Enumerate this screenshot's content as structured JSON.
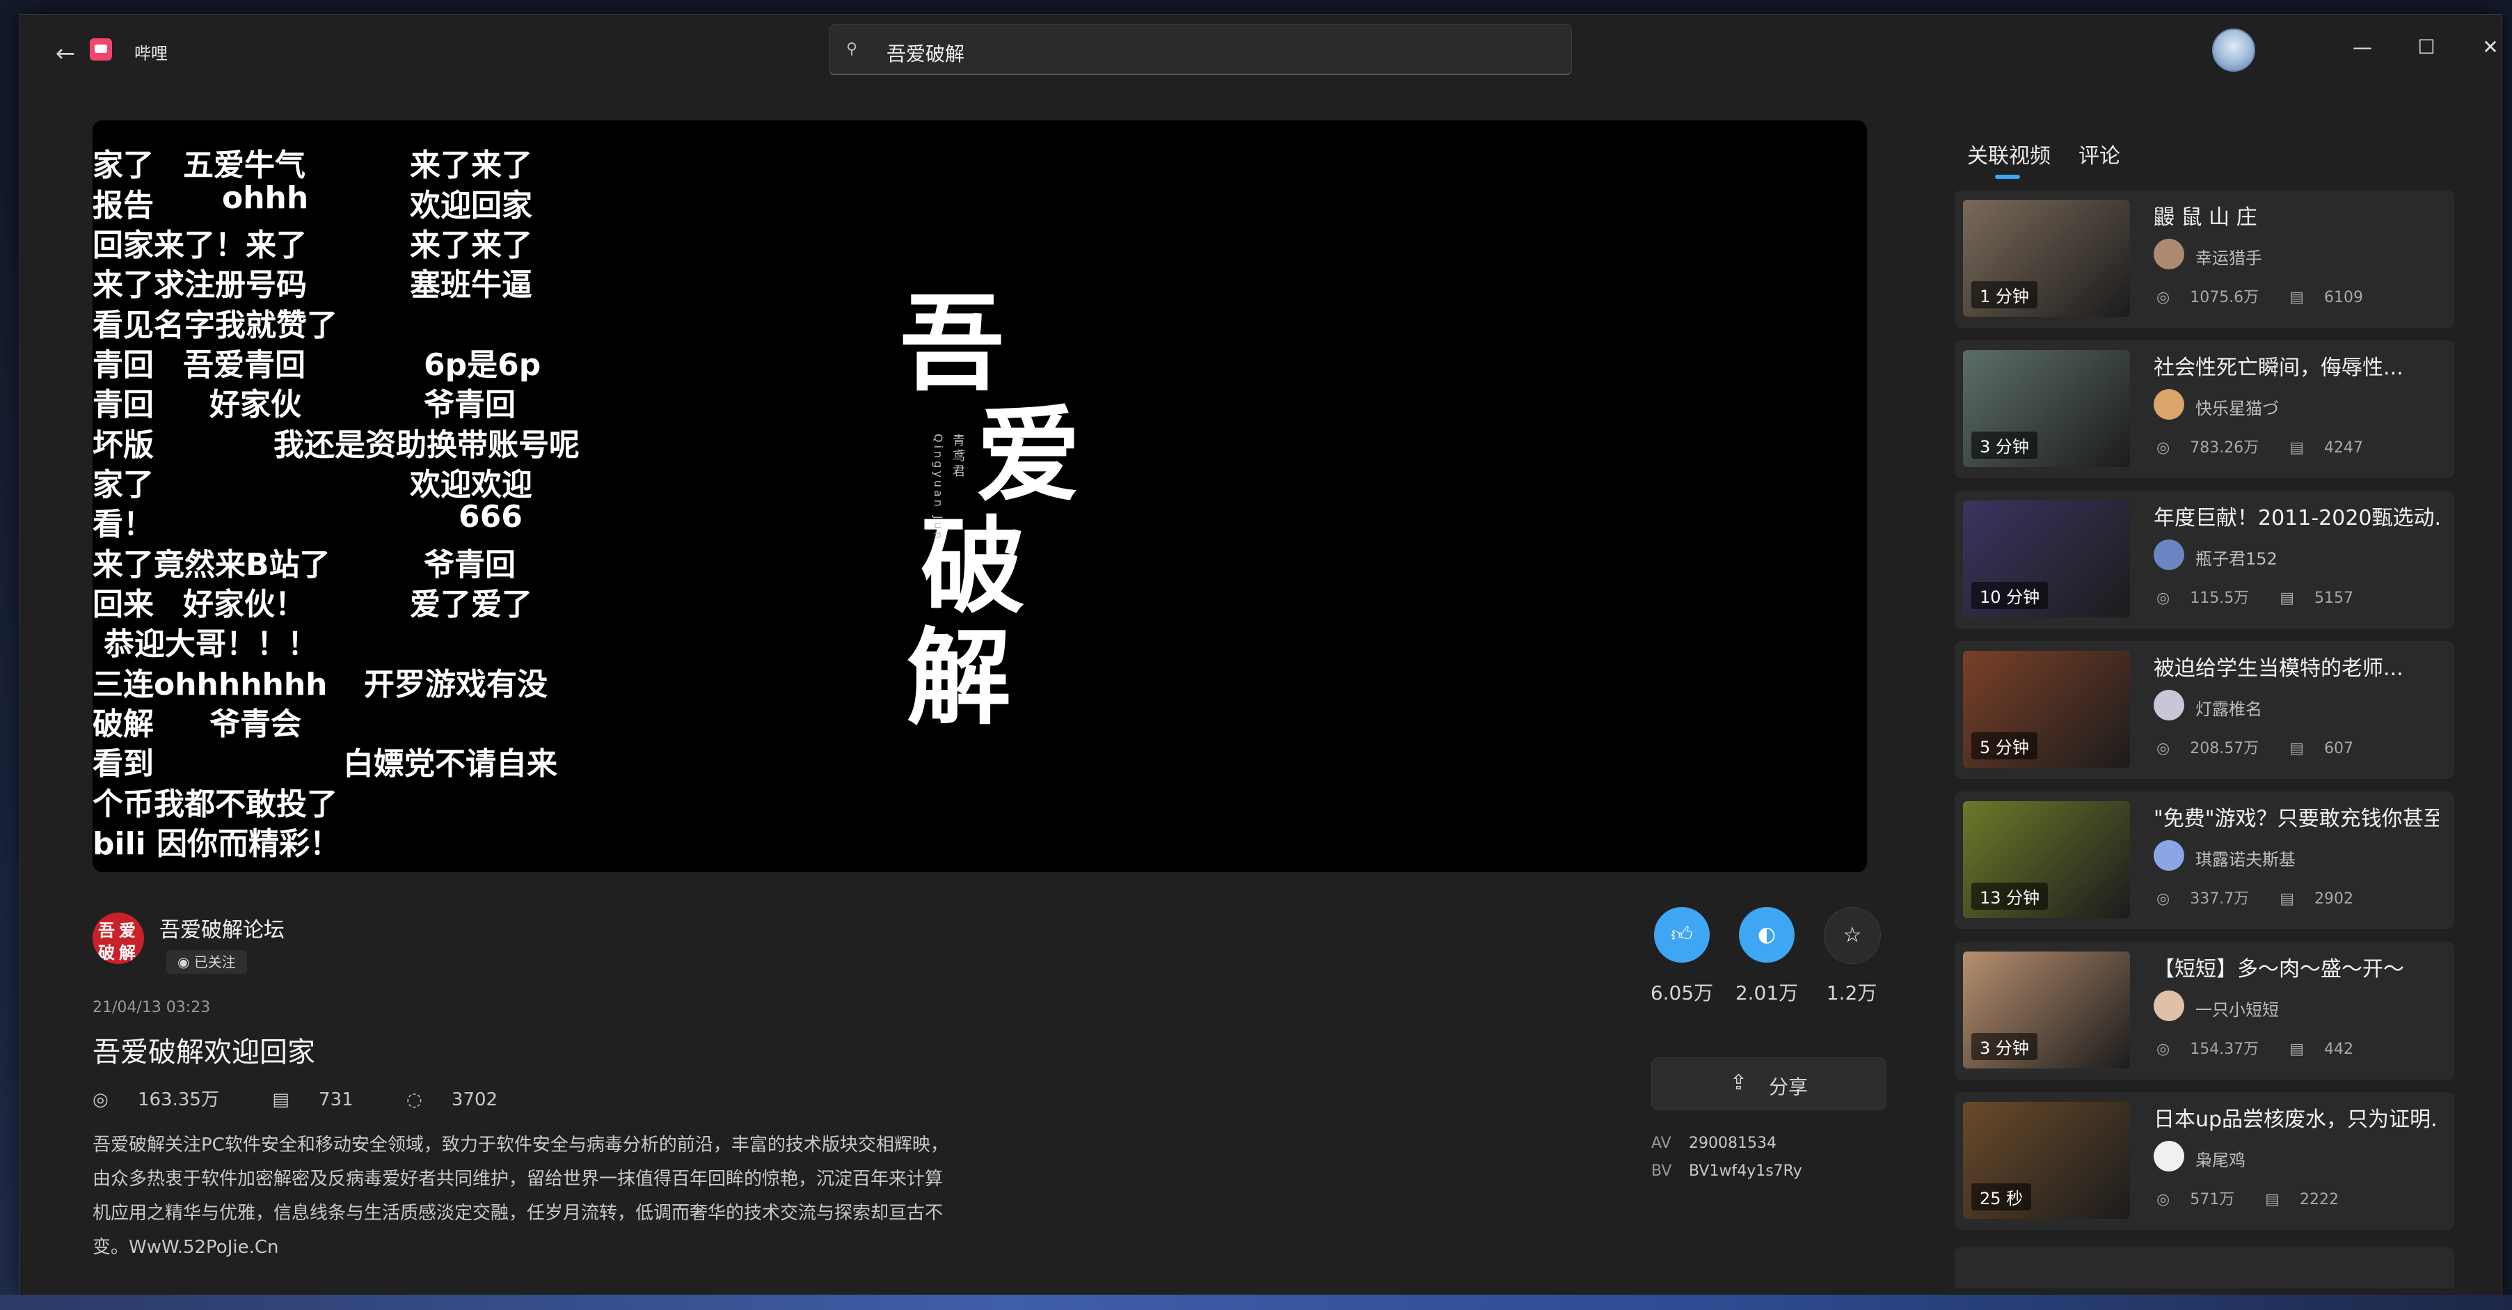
{
  "app": {
    "name": "哔哩"
  },
  "search": {
    "query": "吾爱破解"
  },
  "danmaku": [
    "家了",
    "五爱牛气",
    "来了来了",
    "报告",
    "ohhh",
    "欢迎回家",
    "回家",
    "来了！来了",
    "来了来了",
    "来了",
    "求注册号码",
    "塞班牛逼",
    "看见名字我就赞了",
    "青回",
    "吾爱青回",
    "6p是6p",
    "青回",
    "好家伙",
    "爷青回",
    "坏版",
    "我还是资助换带账号呢",
    "家了",
    "欢迎欢迎",
    "看！",
    "666",
    "来了竟然来B站了",
    "爷青回",
    "回来",
    "好家伙！",
    "爱了爱了",
    "恭迎大哥！！！",
    "三连ohhhhhhh",
    "开罗游戏有没",
    "破解",
    "爷青会",
    "看到",
    "白嫖党不请自来",
    "个币我都不敢投了",
    "bili 因你而精彩！"
  ],
  "cover": {
    "chars": [
      "吾",
      "爱",
      "破",
      "解"
    ],
    "signature_cn": "青鸢君",
    "signature_en": "Qingyuan Jun"
  },
  "uploader": {
    "name": "吾爱破解论坛",
    "followed": "已关注",
    "avatar_text": [
      "吾",
      "爱",
      "破",
      "解"
    ]
  },
  "video": {
    "date": "21/04/13 03:23",
    "title": "吾爱破解欢迎回家",
    "views": "163.35万",
    "danmaku_count": "731",
    "replies": "3702",
    "description": "吾爱破解关注PC软件安全和移动安全领域，致力于软件安全与病毒分析的前沿，丰富的技术版块交相辉映，由众多热衷于软件加密解密及反病毒爱好者共同维护，留给世界一抹值得百年回眸的惊艳，沉淀百年来计算机应用之精华与优雅，信息线条与生活质感淡定交融，任岁月流转，低调而奢华的技术交流与探索却亘古不变。WwW.52PoJie.Cn"
  },
  "actions": {
    "like": "6.05万",
    "coin": "2.01万",
    "favorite": "1.2万",
    "share_label": "分享"
  },
  "ids": {
    "av_label": "AV",
    "av": "290081534",
    "bv_label": "BV",
    "bv": "BV1wf4y1s7Ry"
  },
  "tabs": [
    "关联视频",
    "评论"
  ],
  "related": [
    {
      "title": "鼹 鼠 山 庄",
      "author": "幸运猎手",
      "views": "1075.6万",
      "danmaku": "6109",
      "duration": "1 分钟",
      "thumb_color": "#7a6a5a",
      "avatar_color": "#b08a70"
    },
    {
      "title": "社会性死亡瞬间，侮辱性...",
      "author": "快乐星猫づ",
      "views": "783.26万",
      "danmaku": "4247",
      "duration": "3 分钟",
      "thumb_color": "#5c6e6a",
      "avatar_color": "#d9a56a"
    },
    {
      "title": "年度巨献！2011-2020甄选动...",
      "author": "瓶子君152",
      "views": "115.5万",
      "danmaku": "5157",
      "duration": "10 分钟",
      "thumb_color": "#3b3460",
      "avatar_color": "#6a86c2"
    },
    {
      "title": "被迫给学生当模特的老师...",
      "author": "灯露椎名",
      "views": "208.57万",
      "danmaku": "607",
      "duration": "5 分钟",
      "thumb_color": "#7a4028",
      "avatar_color": "#c7c7d7"
    },
    {
      "title": "\"免费\"游戏？只要敢充钱你甚至...",
      "author": "琪露诺夫斯基",
      "views": "337.7万",
      "danmaku": "2902",
      "duration": "13 分钟",
      "thumb_color": "#6b7a2a",
      "avatar_color": "#8aa6e6"
    },
    {
      "title": "【短短】多～肉～盛～开～",
      "author": "一只小短短",
      "views": "154.37万",
      "danmaku": "442",
      "duration": "3 分钟",
      "thumb_color": "#b89070",
      "avatar_color": "#e0c0a8"
    },
    {
      "title": "日本up品尝核废水，只为证明...",
      "author": "枭尾鸡",
      "views": "571万",
      "danmaku": "2222",
      "duration": "25 秒",
      "thumb_color": "#6a4a2a",
      "avatar_color": "#f0f0f0"
    }
  ],
  "colors": {
    "accent": "#3ea6f2",
    "window_bg": "#202020",
    "card_bg": "#2a2a2a"
  }
}
